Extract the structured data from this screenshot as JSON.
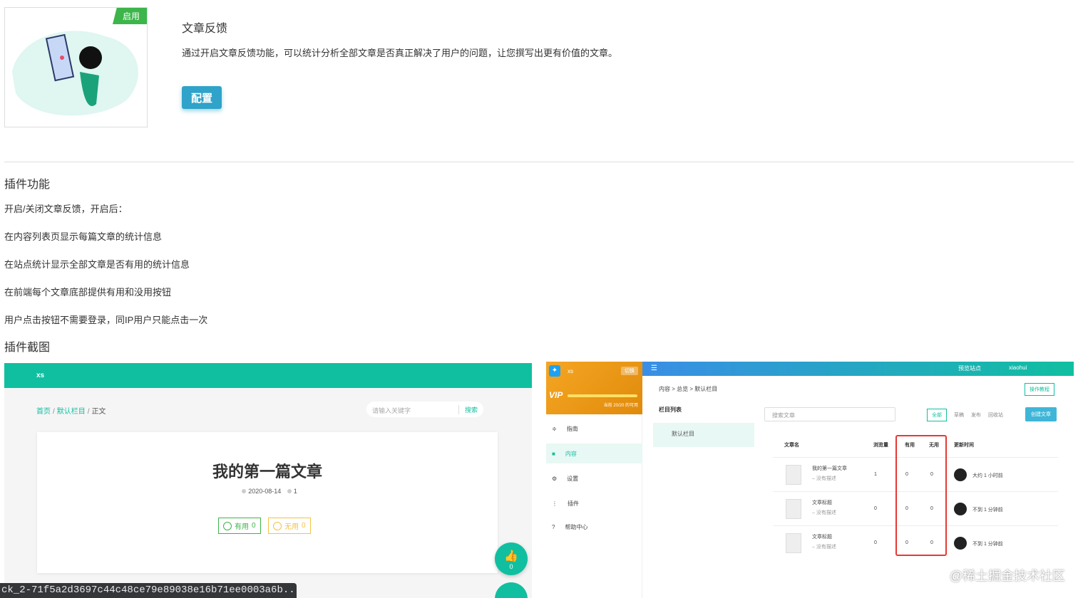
{
  "plugin": {
    "badge": "启用",
    "title": "文章反馈",
    "description": "通过开启文章反馈功能，可以统计分析全部文章是否真正解决了用户的问题，让您撰写出更有价值的文章。",
    "config_label": "配置"
  },
  "features": {
    "heading": "插件功能",
    "items": [
      "开启/关闭文章反馈，开启后：",
      "在内容列表页显示每篇文章的统计信息",
      "在站点统计显示全部文章是否有用的统计信息",
      "在前端每个文章底部提供有用和没用按钮",
      "用户点击按钮不需要登录，同IP用户只能点击一次"
    ]
  },
  "screenshots": {
    "heading": "插件截图",
    "frontend": {
      "site_name": "xs",
      "crumb_home": "首页",
      "crumb_sep": "/",
      "crumb_column": "默认栏目",
      "crumb_current": "正文",
      "search_placeholder": "请输入关键字",
      "search_button": "搜索",
      "article_title": "我的第一篇文章",
      "article_date": "2020-08-14",
      "article_views": "1",
      "useful_label": "有用",
      "useful_count": "0",
      "useless_label": "无用",
      "useless_count": "0",
      "like_count": "0"
    },
    "admin": {
      "site_name": "xs",
      "switch_label": "切换",
      "vip_label": "VIP",
      "quota": "当前 20/20 的可用",
      "nav": [
        "指南",
        "内容",
        "设置",
        "插件",
        "帮助中心"
      ],
      "top_preview": "预览站点",
      "top_user": "xiaohui",
      "crumb": "内容 > 总览 > 默认栏目",
      "help_btn": "操作教程",
      "column_list": "栏目列表",
      "column_default": "默认栏目",
      "search_placeholder": "搜索文章",
      "tabs": [
        "全部",
        "草稿",
        "发布",
        "回收站"
      ],
      "create_btn": "创建文章",
      "headers": [
        "文章名",
        "浏览量",
        "有用",
        "无用",
        "更新时间"
      ],
      "rows": [
        {
          "title": "我的第一篇文章",
          "desc": "– 没有描述",
          "views": "1",
          "useful": "0",
          "useless": "0",
          "time": "大约 1 小时前"
        },
        {
          "title": "文章标题",
          "desc": "– 没有描述",
          "views": "0",
          "useful": "0",
          "useless": "0",
          "time": "不到 1 分钟前"
        },
        {
          "title": "文章标题",
          "desc": "– 没有描述",
          "views": "0",
          "useful": "0",
          "useless": "0",
          "time": "不到 1 分钟前"
        }
      ]
    }
  },
  "watermark": "@稀土掘金技术社区",
  "status_url": "ck_2-71f5a2d3697c44c48ce79e89038e16b71ee0003a6b...",
  "colors": {
    "accent": "#10bfa0",
    "button": "#2fa3c9",
    "badge": "#3cb54a",
    "highlight": "#e53935"
  }
}
